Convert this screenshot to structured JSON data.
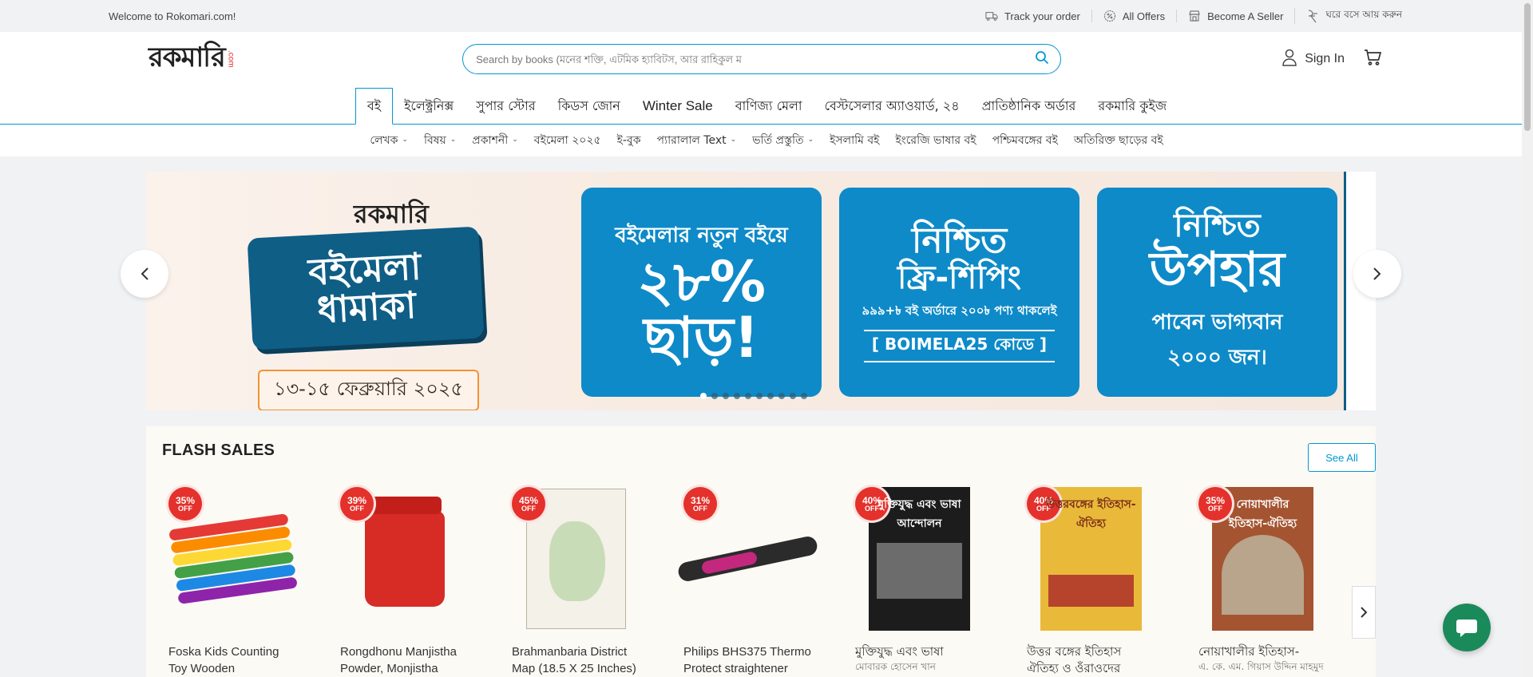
{
  "topbar": {
    "welcome": "Welcome to Rokomari.com!",
    "links": [
      {
        "label": "Track your order",
        "icon": "truck-icon"
      },
      {
        "label": "All Offers",
        "icon": "offer-icon"
      },
      {
        "label": "Become A Seller",
        "icon": "store-icon"
      },
      {
        "label": "ঘরে বসে আয় করুন",
        "icon": "earn-icon"
      }
    ]
  },
  "header": {
    "logo_text": "রকমারি",
    "logo_sub": ".com",
    "search_placeholder": "Search by books (মনের শক্তি, এটমিক হ্যাবিটস, আর রাহিকুল ম",
    "signin_label": "Sign In"
  },
  "main_nav": [
    {
      "label": "বই",
      "active": true
    },
    {
      "label": "ইলেক্ট্রনিক্স"
    },
    {
      "label": "সুপার স্টোর"
    },
    {
      "label": "কিডস জোন"
    },
    {
      "label": "Winter Sale"
    },
    {
      "label": "বাণিজ্য মেলা"
    },
    {
      "label": "বেস্টসেলার অ্যাওয়ার্ড, ২৪"
    },
    {
      "label": "প্রাতিষ্ঠানিক অর্ডার"
    },
    {
      "label": "রকমারি কুইজ"
    }
  ],
  "sub_nav": [
    {
      "label": "লেখক",
      "dropdown": true
    },
    {
      "label": "বিষয়",
      "dropdown": true
    },
    {
      "label": "প্রকাশনী",
      "dropdown": true
    },
    {
      "label": "বইমেলা ২০২৫",
      "dropdown": false
    },
    {
      "label": "ই-বুক",
      "dropdown": false
    },
    {
      "label": "প্যারালাল Text",
      "dropdown": true
    },
    {
      "label": "ভর্তি প্রস্তুতি",
      "dropdown": true
    },
    {
      "label": "ইসলামি বই",
      "dropdown": false
    },
    {
      "label": "ইংরেজি ভাষার বই",
      "dropdown": false
    },
    {
      "label": "পশ্চিমবঙ্গের বই",
      "dropdown": false
    },
    {
      "label": "অতিরিক্ত ছাড়ের বই",
      "dropdown": false
    }
  ],
  "banner": {
    "brand": "রকমারি",
    "headline_1": "বইমেলা",
    "headline_2": "ধামাকা",
    "date": "১৩-১৫ ফেব্রুয়ারি ২০২৫",
    "promo1": {
      "line1": "বইমেলার নতুন বইয়ে",
      "big": "২৮%",
      "big2": "ছাড়!"
    },
    "promo2": {
      "line1": "নিশ্চিত",
      "mid": "ফ্রি-শিপিং",
      "small": "৯৯৯+৳ বই অর্ডারে ২০০৳ পণ্য থাকলেই",
      "code": "[ BOIMELA25 কোডে ]"
    },
    "promo3": {
      "line1": "নিশ্চিত",
      "mid": "উপহার",
      "small": "পাবেন ভাগ্যবান",
      "small2": "২০০০ জন।"
    },
    "slide_count": 10,
    "active_slide": 0
  },
  "flash": {
    "title": "FLASH SALES",
    "see_all": "See All",
    "products": [
      {
        "discount": "35%",
        "off": "OFF",
        "name": "Foska Kids Counting Toy Wooden Mathematical...",
        "author": "",
        "image": "sticks"
      },
      {
        "discount": "39%",
        "off": "OFF",
        "name": "Rongdhonu Manjistha Powder, Monjistha Powder...",
        "author": "",
        "image": "jar"
      },
      {
        "discount": "45%",
        "off": "OFF",
        "name": "Brahmanbaria District Map (18.5 X 25 Inches)",
        "author": "",
        "image": "map"
      },
      {
        "discount": "31%",
        "off": "OFF",
        "name": "Philips BHS375 Thermo Protect straightener",
        "author": "",
        "image": "straightener"
      },
      {
        "discount": "40%",
        "off": "OFF",
        "name": "মুক্তিযুদ্ধ এবং ভাষা আন্দোলন",
        "author": "মোবারক হোসেন খান",
        "image": "book1",
        "cover": "মুক্তিযুদ্ধ এবং ভাষা আন্দোলন"
      },
      {
        "discount": "40%",
        "off": "OFF",
        "name": "উত্তর বঙ্গের ইতিহাস ঐতিহ্য ও ওঁরাওদের জীবনধারা",
        "author": "",
        "image": "book2",
        "cover": "উত্তরবঙ্গের ইতিহাস-ঐতিহ্য"
      },
      {
        "discount": "35%",
        "off": "OFF",
        "name": "নোয়াখালীর ইতিহাস- ঐতিহ্য",
        "author": "এ. কে. এম. গিয়াস উদ্দিন মাহমুদ",
        "image": "book3",
        "cover": "নোয়াখালীর ইতিহাস-ঐতিহ্য"
      }
    ]
  },
  "colors": {
    "accent": "#0397d3",
    "badge": "#e4312b",
    "chat": "#1b8a5a",
    "promo": "#0e8ac8"
  }
}
